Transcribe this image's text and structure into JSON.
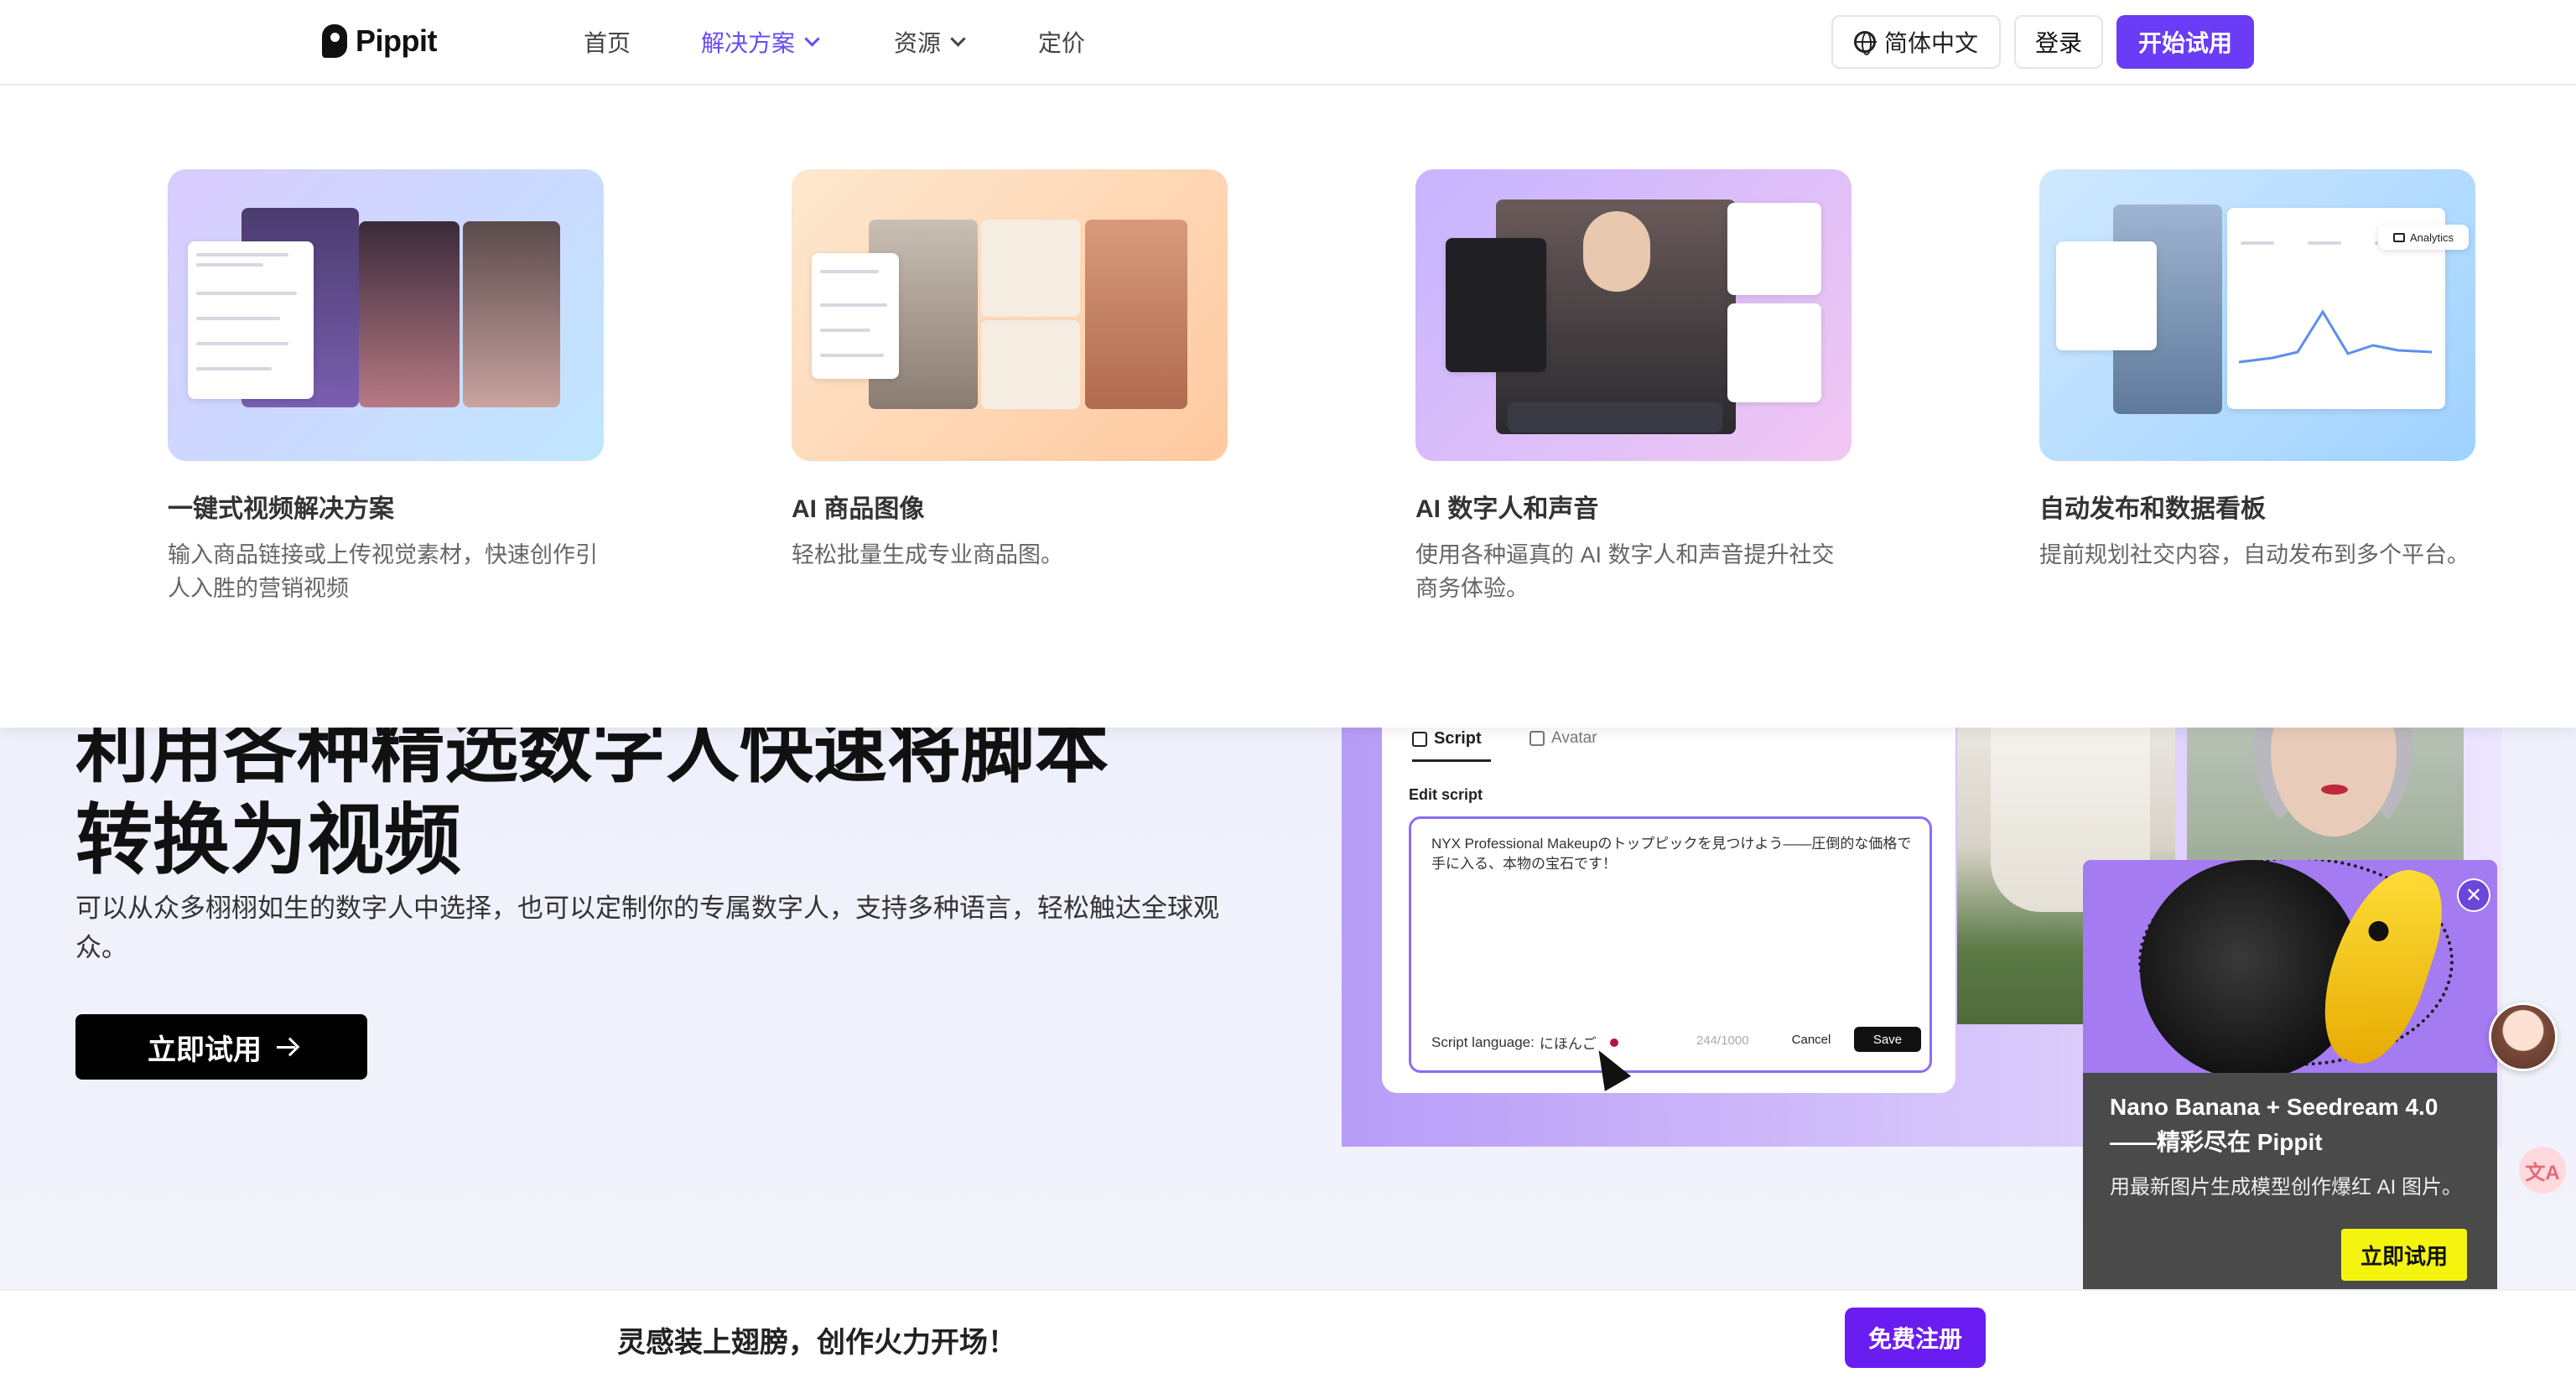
{
  "brand": {
    "name": "Pippit"
  },
  "nav": {
    "links": [
      {
        "label": "首页"
      },
      {
        "label": "解决方案"
      },
      {
        "label": "资源"
      },
      {
        "label": "定价"
      }
    ],
    "language": "简体中文",
    "login": "登录",
    "start": "开始试用",
    "accent_color": "#6a3cf5"
  },
  "solutions_menu": {
    "cards": [
      {
        "title": "一键式视频解决方案",
        "desc": "输入商品链接或上传视觉素材，快速创作引人入胜的营销视频"
      },
      {
        "title": "AI 商品图像",
        "desc": "轻松批量生成专业商品图。"
      },
      {
        "title": "AI 数字人和声音",
        "desc": "使用各种逼真的 AI 数字人和声音提升社交商务体验。"
      },
      {
        "title": "自动发布和数据看板",
        "desc": "提前规划社交内容，自动发布到多个平台。"
      }
    ],
    "card4_badge": "Analytics"
  },
  "hero": {
    "title_clipped": "利用各种精选数字人快速将脚本",
    "title": "转换为视频",
    "desc": "可以从众多栩栩如生的数字人中选择，也可以定制你的专属数字人，支持多种语言，轻松触达全球观众。",
    "cta": "立即试用"
  },
  "editor": {
    "tab_script": "Script",
    "tab_avatar": "Avatar",
    "edit_label": "Edit script",
    "script_text": "NYX Professional Makeupのトップピックを見つけよう——圧倒的な価格で手に入る、本物の宝石です！",
    "script_language_label": "Script language:",
    "script_language_value": "にほんご",
    "counter": "244/1000",
    "cancel": "Cancel",
    "save": "Save"
  },
  "promo": {
    "title": "Nano Banana + Seedream 4.0 ——精彩尽在 Pippit",
    "desc": "用最新图片生成模型创作爆红 AI 图片。",
    "cta": "立即试用",
    "button_color": "#f4f40e"
  },
  "bottom_bar": {
    "text": "灵感装上翅膀，创作火力开场！",
    "signup": "免费注册",
    "signup_color": "#6a1df0"
  },
  "icons": [
    "logo-icon",
    "chevron-down-icon",
    "globe-icon",
    "arrow-right-icon",
    "script-icon",
    "avatar-icon",
    "close-icon",
    "translate-icon",
    "cursor-icon"
  ]
}
